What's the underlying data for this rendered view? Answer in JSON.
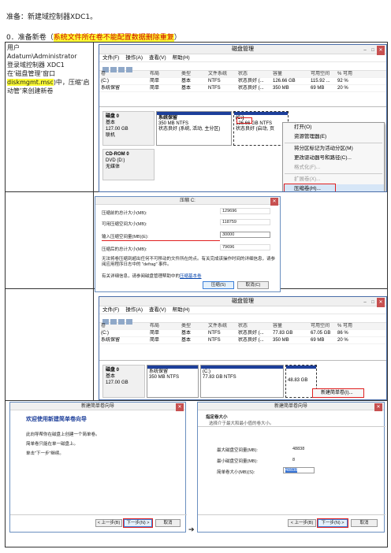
{
  "doc": {
    "header": "准备：新建域控制器XDC1。",
    "section_num": "0．准备新卷（",
    "section_hl": "系统文件所在卷不能配置数据删除重复",
    "section_end": "）",
    "left_lines": [
      "用户 Adatum\\Administrator",
      "登录域控制器 XDC1",
      "在‘磁盘管理’窗口",
      "(diskmgmt.msc)中，压缩‘启",
      "动管’来创建新卷"
    ],
    "left_hl": "diskmgmt.msc"
  },
  "dm1": {
    "title": "磁盘管理",
    "menu": [
      "文件(F)",
      "操作(A)",
      "查看(V)",
      "帮助(H)"
    ],
    "cols": [
      "卷",
      "布局",
      "类型",
      "文件系统",
      "状态",
      "容量",
      "可用空间",
      "% 可用"
    ],
    "rows": [
      [
        "(C:)",
        "简单",
        "基本",
        "NTFS",
        "状态良好 (...",
        "126.66 GB",
        "115.92 ...",
        "92 %"
      ],
      [
        "系统保留",
        "简单",
        "基本",
        "NTFS",
        "状态良好 (...",
        "350 MB",
        "69 MB",
        "20 %"
      ]
    ],
    "disk0": [
      "磁盘 0",
      "基本",
      "127.00 GB",
      "联机"
    ],
    "p1": [
      "系统保留",
      "350 MB NTFS",
      "状态良好 (系统, 活动, 主分区)"
    ],
    "p2": [
      "(C:)",
      "126.66 GB NTFS",
      "状态良好 (启动, 页"
    ],
    "cd": [
      "CD-ROM 0",
      "DVD (D:)",
      "",
      "无媒体"
    ],
    "ctx": [
      "打开(O)",
      "资源管理器(E)",
      "将分区标记为活动分区(M)",
      "更改驱动器号和路径(C)...",
      "格式化(F)...",
      "扩展卷(X)...",
      "压缩卷(H)..."
    ],
    "ctx_disabled": [
      4,
      5
    ]
  },
  "shrink": {
    "title": "压缩 C:",
    "l1": "压缩前的总计大小(MB):",
    "v1": "129696",
    "l2": "可用压缩空间大小(MB):",
    "v2": "118759",
    "l3": "输入压缩空间量(MB)(E):",
    "v3": "30000",
    "l4": "压缩后的总计大小(MB):",
    "v4": "79696",
    "note": "无法将卷压缩到超出任何不可移动的文件所在的点。有关完成该操作时间的详细信息，请参阅应用程序日志中的 \"defrag\" 事件。",
    "more": "有关详细信息，请参阅磁盘管理帮助中的",
    "link": "压缩基本卷",
    "ok": "压缩(S)",
    "cancel": "取消(C)"
  },
  "dm2": {
    "title": "磁盘管理",
    "rows": [
      [
        "(C:)",
        "简单",
        "基本",
        "NTFS",
        "状态良好 (...",
        "77.83 GB",
        "67.05 GB",
        "86 %"
      ],
      [
        "系统保留",
        "简单",
        "基本",
        "NTFS",
        "状态良好 (...",
        "350 MB",
        "69 MB",
        "20 %"
      ]
    ],
    "disk0": [
      "磁盘 0",
      "基本",
      "127.00 GB"
    ],
    "p1": [
      "系统保留",
      "350 MB NTFS"
    ],
    "p2": [
      "(C:)",
      "77.83 GB NTFS"
    ],
    "p3": "48.83 GB",
    "ctx": "新建简单卷(I)..."
  },
  "wiz1": {
    "title": "新建简单卷向导",
    "heading": "欢迎使用新建简单卷向导",
    "p1": "此向导帮你在磁盘上创建一个简单卷。",
    "p2": "简单卷只能在单一磁盘上。",
    "p3": "单击\"下一步\"继续。",
    "back": "< 上一步(B)",
    "next": "下一步(N) >",
    "cancel": "取消"
  },
  "wiz2": {
    "title": "新建简单卷向导",
    "heading": "指定卷大小",
    "sub": "选择介于最大和最小值的卷大小。",
    "l1": "最大磁盘空间量(MB):",
    "v1": "48838",
    "l2": "最小磁盘空间量(MB):",
    "v2": "8",
    "l3": "简单卷大小(MB)(S):",
    "v3": "48838",
    "back": "< 上一步(B)",
    "next": "下一步(N) >",
    "cancel": "取消"
  },
  "arrow": "➔"
}
